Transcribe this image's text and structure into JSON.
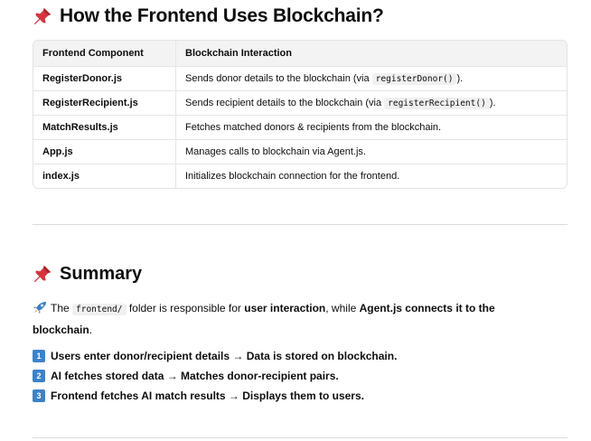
{
  "heading1": "How the Frontend Uses Blockchain?",
  "table": {
    "headers": [
      "Frontend Component",
      "Blockchain Interaction"
    ],
    "rows": [
      {
        "component": "RegisterDonor.js",
        "pre": "Sends donor details to the blockchain (via ",
        "code": "registerDonor()",
        "post": ")."
      },
      {
        "component": "RegisterRecipient.js",
        "pre": "Sends recipient details to the blockchain (via ",
        "code": "registerRecipient()",
        "post": ")."
      },
      {
        "component": "MatchResults.js",
        "pre": "Fetches matched donors & recipients from the blockchain.",
        "code": "",
        "post": ""
      },
      {
        "component": "App.js",
        "pre": "Manages calls to blockchain via Agent.js.",
        "code": "",
        "post": ""
      },
      {
        "component": "index.js",
        "pre": "Initializes blockchain connection for the frontend.",
        "code": "",
        "post": ""
      }
    ]
  },
  "heading2": "Summary",
  "summary": {
    "t1": "The ",
    "code": "frontend/",
    "t2": " folder is responsible for ",
    "b1": "user interaction",
    "t3": ", while ",
    "b2": "Agent.js connects it to the blockchain",
    "t4": "."
  },
  "list": [
    {
      "num": "1",
      "text": "Users enter donor/recipient details → Data is stored on blockchain."
    },
    {
      "num": "2",
      "text": "AI fetches stored data → Matches donor-recipient pairs."
    },
    {
      "num": "3",
      "text": "Frontend fetches AI match results → Displays them to users."
    }
  ],
  "colors": {
    "pin": "#d4343e",
    "number_badge": "#3c82c9",
    "header_bg": "#f3f3f3"
  },
  "icons": {
    "heading": "pushpin-icon",
    "summary": "rocket-icon"
  }
}
